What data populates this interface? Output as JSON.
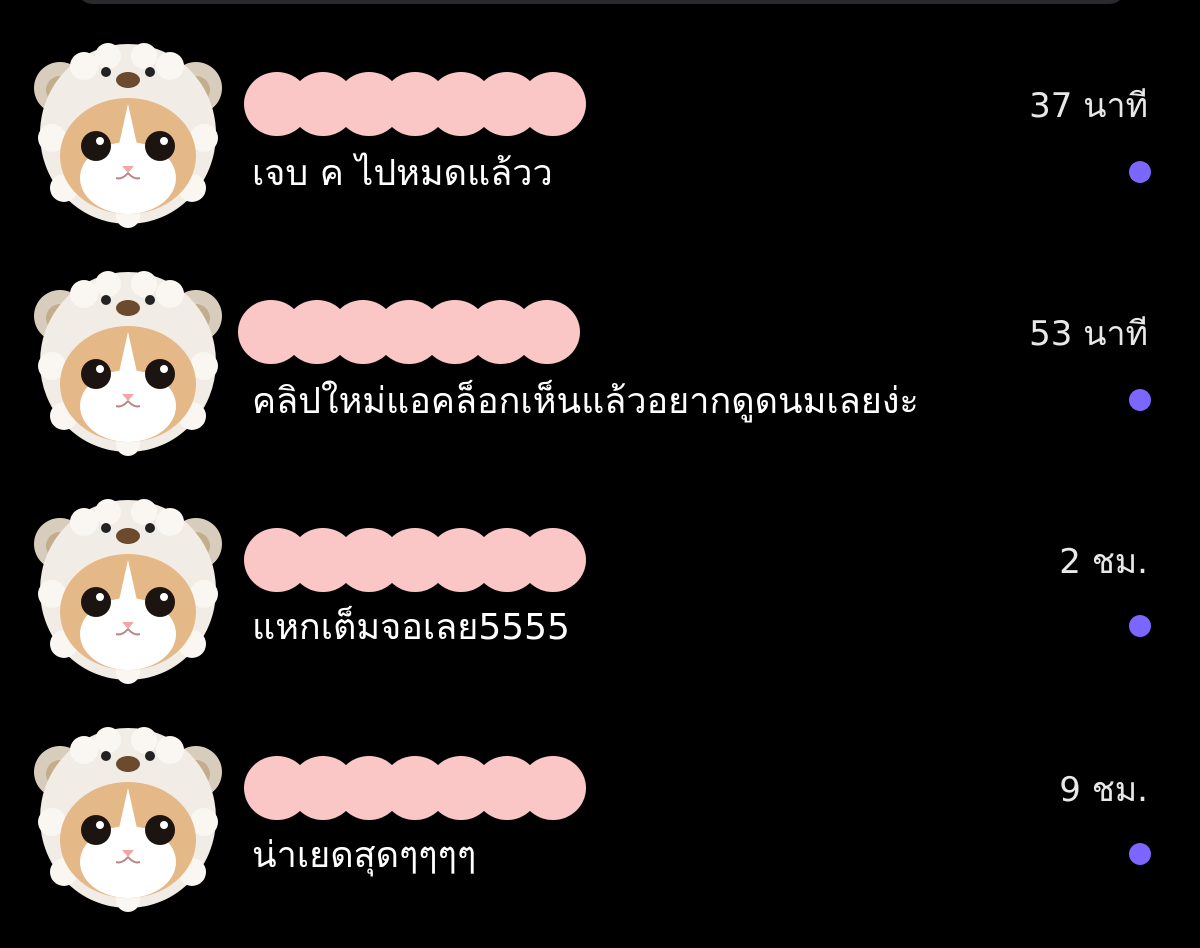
{
  "theme": {
    "background": "#000000",
    "text": "#ffffff",
    "redaction_color": "#fbc6c6",
    "unread_dot_color": "#7b66ff"
  },
  "conversations": [
    {
      "avatar_icon": "cat-in-bear-hat-avatar",
      "message": "เจบ ค ไปหมดแล้วว",
      "time": "37 นาที",
      "unread": true
    },
    {
      "avatar_icon": "cat-in-bear-hat-avatar",
      "message": "คลิปใหม่แอคล็อกเห็นแล้วอยากดูดนมเลยง่ะ",
      "time": "53 นาที",
      "unread": true
    },
    {
      "avatar_icon": "cat-in-bear-hat-avatar",
      "message": "แหกเต็มจอเลย5555",
      "time": "2 ชม.",
      "unread": true
    },
    {
      "avatar_icon": "cat-in-bear-hat-avatar",
      "message": "น่าเยดสุดๆๆๆๆ",
      "time": "9 ชม.",
      "unread": true
    }
  ]
}
